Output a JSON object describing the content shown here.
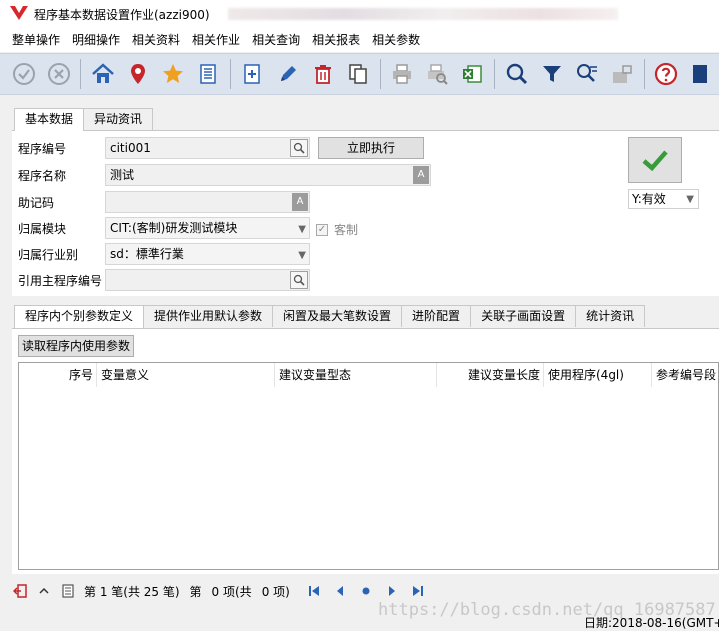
{
  "window": {
    "title": "程序基本数据设置作业(azzi900)"
  },
  "menu": [
    "整单操作",
    "明细操作",
    "相关资料",
    "相关作业",
    "相关查询",
    "相关报表",
    "相关参数"
  ],
  "upper_tabs": [
    "基本数据",
    "异动资讯"
  ],
  "form": {
    "program_no_label": "程序编号",
    "program_no_value": "citi001",
    "exec_button": "立即执行",
    "program_name_label": "程序名称",
    "program_name_value": "测试",
    "mnemonic_label": "助记码",
    "mnemonic_value": "",
    "module_label": "归属模块",
    "module_value": "CIT:(客制)研发测试模块",
    "custom_label": "客制",
    "custom_checked": true,
    "industry_label": "归属行业别",
    "industry_value": "sd：標準行業",
    "main_program_label": "引用主程序编号",
    "main_program_value": "",
    "status_value": "Y:有效"
  },
  "lower_tabs": [
    "程序内个别参数定义",
    "提供作业用默认参数",
    "闲置及最大笔数设置",
    "进阶配置",
    "关联子画面设置",
    "统计资讯"
  ],
  "read_button": "读取程序内使用参数",
  "grid": {
    "columns": [
      "序号",
      "变量意义",
      "建议变量型态",
      "建议变量长度",
      "使用程序(4gl)",
      "参考编号段"
    ],
    "rows": []
  },
  "status": {
    "record": "第 1 笔(共 25 笔)",
    "item_prefix": "第",
    "item": "0 项(共",
    "item_total": "0 项)",
    "date": "日期:2018-08-16(GMT+"
  },
  "watermark": "https://blog.csdn.net/qq_16987587",
  "colors": {
    "toolbar_bg": "#dbe3ee",
    "accent_blue": "#2b63b5",
    "check_green": "#3a9b3a",
    "logo_red": "#d8272d"
  }
}
